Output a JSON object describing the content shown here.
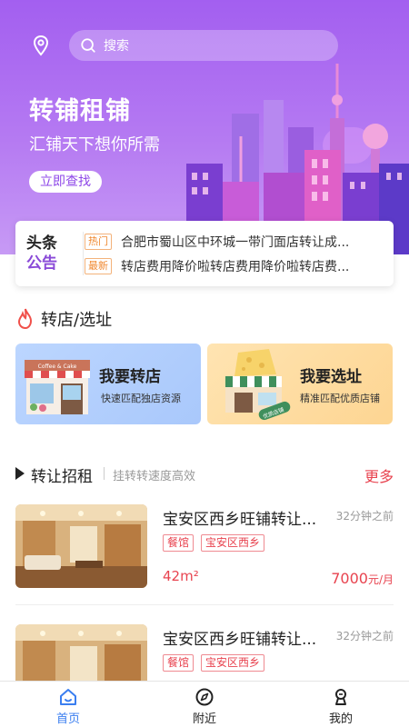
{
  "search": {
    "placeholder": "搜索"
  },
  "hero": {
    "title": "转铺租铺",
    "subtitle": "汇铺天下想你所需",
    "button": "立即查找"
  },
  "notice": {
    "logo_line1": "头条",
    "logo_line2": "公告",
    "items": [
      {
        "tag": "热门",
        "text": "合肥市蜀山区中环城一带门面店转让成..."
      },
      {
        "tag": "最新",
        "text": "转店费用降价啦转店费用降价啦转店费..."
      }
    ]
  },
  "section_transfer": {
    "title": "转店/选址",
    "cards": [
      {
        "title": "我要转店",
        "subtitle": "快速匹配独店资源",
        "sign": "Coffee & Cake"
      },
      {
        "title": "我要选址",
        "subtitle": "精准匹配优质店铺",
        "sign": "优质店铺"
      }
    ]
  },
  "section_listings": {
    "title": "转让招租",
    "subtitle": "挂转转速度高效",
    "more": "更多",
    "items": [
      {
        "title": "宝安区西乡旺铺转让...",
        "time": "32分钟之前",
        "tags": [
          "餐馆",
          "宝安区西乡"
        ],
        "area": "42m²",
        "price": "7000",
        "price_unit": "元/月"
      },
      {
        "title": "宝安区西乡旺铺转让...",
        "time": "32分钟之前",
        "tags": [
          "餐馆",
          "宝安区西乡"
        ]
      }
    ]
  },
  "tabbar": {
    "items": [
      {
        "label": "首页",
        "active": true
      },
      {
        "label": "附近"
      },
      {
        "label": "我的"
      }
    ]
  },
  "colors": {
    "accent": "#a35ff0",
    "price": "#e8434f",
    "tab_active": "#3a7ef0"
  }
}
